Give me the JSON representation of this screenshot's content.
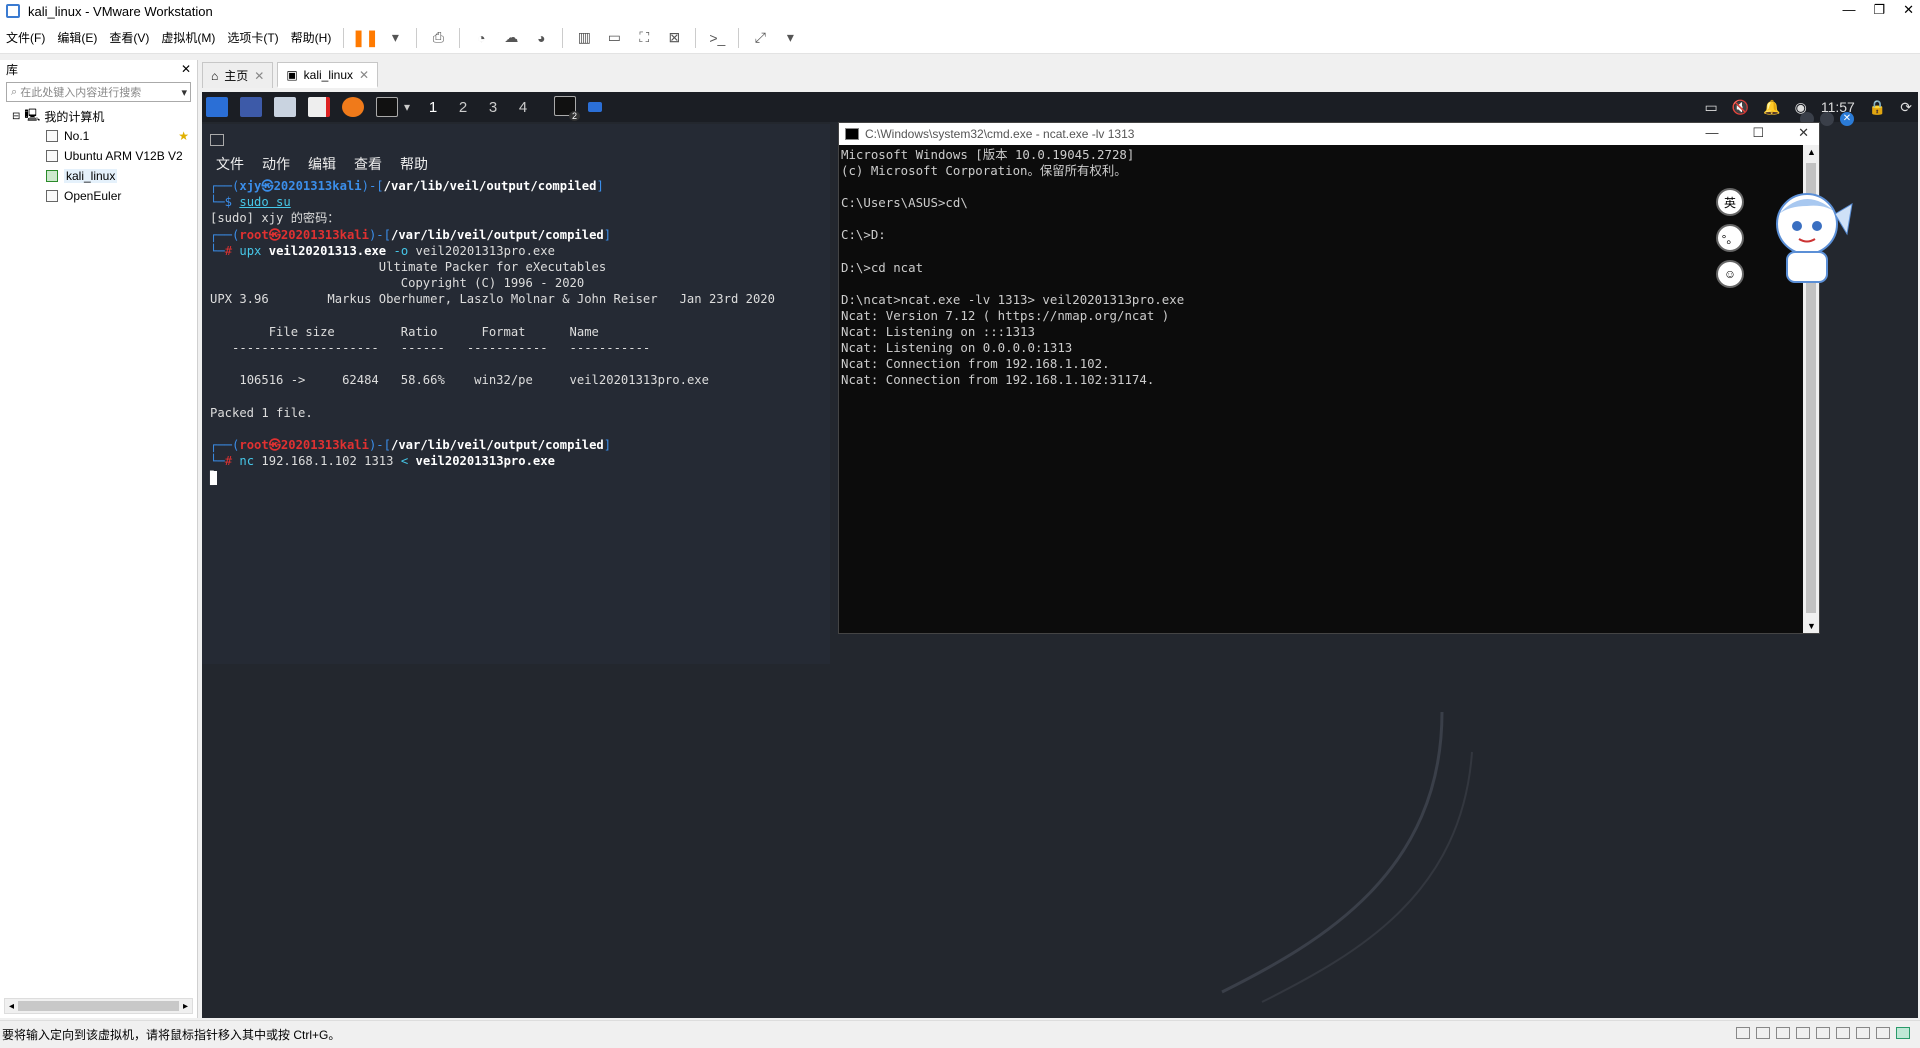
{
  "window": {
    "title": "kali_linux - VMware Workstation"
  },
  "menubar": {
    "items": [
      "文件(F)",
      "编辑(E)",
      "查看(V)",
      "虚拟机(M)",
      "选项卡(T)",
      "帮助(H)"
    ]
  },
  "library": {
    "title": "库",
    "search_placeholder": "在此处键入内容进行搜索",
    "root": "我的计算机",
    "vms": [
      {
        "name": "No.1",
        "favorite": true
      },
      {
        "name": "Ubuntu ARM V12B V2"
      },
      {
        "name": "kali_linux",
        "running": true
      },
      {
        "name": "OpenEuler"
      }
    ]
  },
  "tabs": [
    {
      "label": "主页"
    },
    {
      "label": "kali_linux",
      "active": true
    }
  ],
  "vm_panel": {
    "workspaces": [
      "1",
      "2",
      "3",
      "4"
    ],
    "current_workspace": "1",
    "badge": "2",
    "clock": "11:57"
  },
  "kali_terminal": {
    "menu": [
      "文件",
      "动作",
      "编辑",
      "查看",
      "帮助"
    ],
    "prompt1_user": "xjy",
    "host": "20201313kali",
    "path": "/var/lib/veil/output/compiled",
    "cmd1": "sudo su",
    "sudo_prompt": "[sudo] xjy 的密码：",
    "root_user": "root",
    "cmd2_prog": "upx",
    "cmd2_args": "veil20201313.exe",
    "cmd2_opt": "-o",
    "cmd2_out": "veil20201313pro.exe",
    "upx_banner1": "Ultimate Packer for eXecutables",
    "upx_banner2": "Copyright (C) 1996 - 2020",
    "upx_version_line": "UPX 3.96        Markus Oberhumer, Laszlo Molnar & John Reiser   Jan 23rd 2020",
    "table_header": "File size         Ratio      Format      Name",
    "table_sep": "--------------------   ------   -----------   -----------",
    "table_row": "106516 ->     62484   58.66%    win32/pe     veil20201313pro.exe",
    "packed": "Packed 1 file.",
    "cmd3_prog": "nc",
    "cmd3_args": "192.168.1.102 1313",
    "cmd3_redirect": "<",
    "cmd3_file": "veil20201313pro.exe"
  },
  "cmd_window": {
    "title": "C:\\Windows\\system32\\cmd.exe - ncat.exe  -lv 1313",
    "lines": [
      "Microsoft Windows [版本 10.0.19045.2728]",
      "(c) Microsoft Corporation。保留所有权利。",
      "",
      "C:\\Users\\ASUS>cd\\",
      "",
      "C:\\>D:",
      "",
      "D:\\>cd ncat",
      "",
      "D:\\ncat>ncat.exe -lv 1313> veil20201313pro.exe",
      "Ncat: Version 7.12 ( https://nmap.org/ncat )",
      "Ncat: Listening on :::1313",
      "Ncat: Listening on 0.0.0.0:1313",
      "Ncat: Connection from 192.168.1.102.",
      "Ncat: Connection from 192.168.1.102:31174."
    ]
  },
  "floating_buttons": [
    "英",
    "°。",
    "☺"
  ],
  "status_bar": {
    "text": "要将输入定向到该虚拟机，请将鼠标指针移入其中或按 Ctrl+G。"
  },
  "colors": {
    "kali_bg": "#23272e",
    "terminal_bg": "#252a34",
    "prompt_blue": "#3b8eea",
    "root_red": "#e03131",
    "pause_orange": "#ff7a00"
  }
}
